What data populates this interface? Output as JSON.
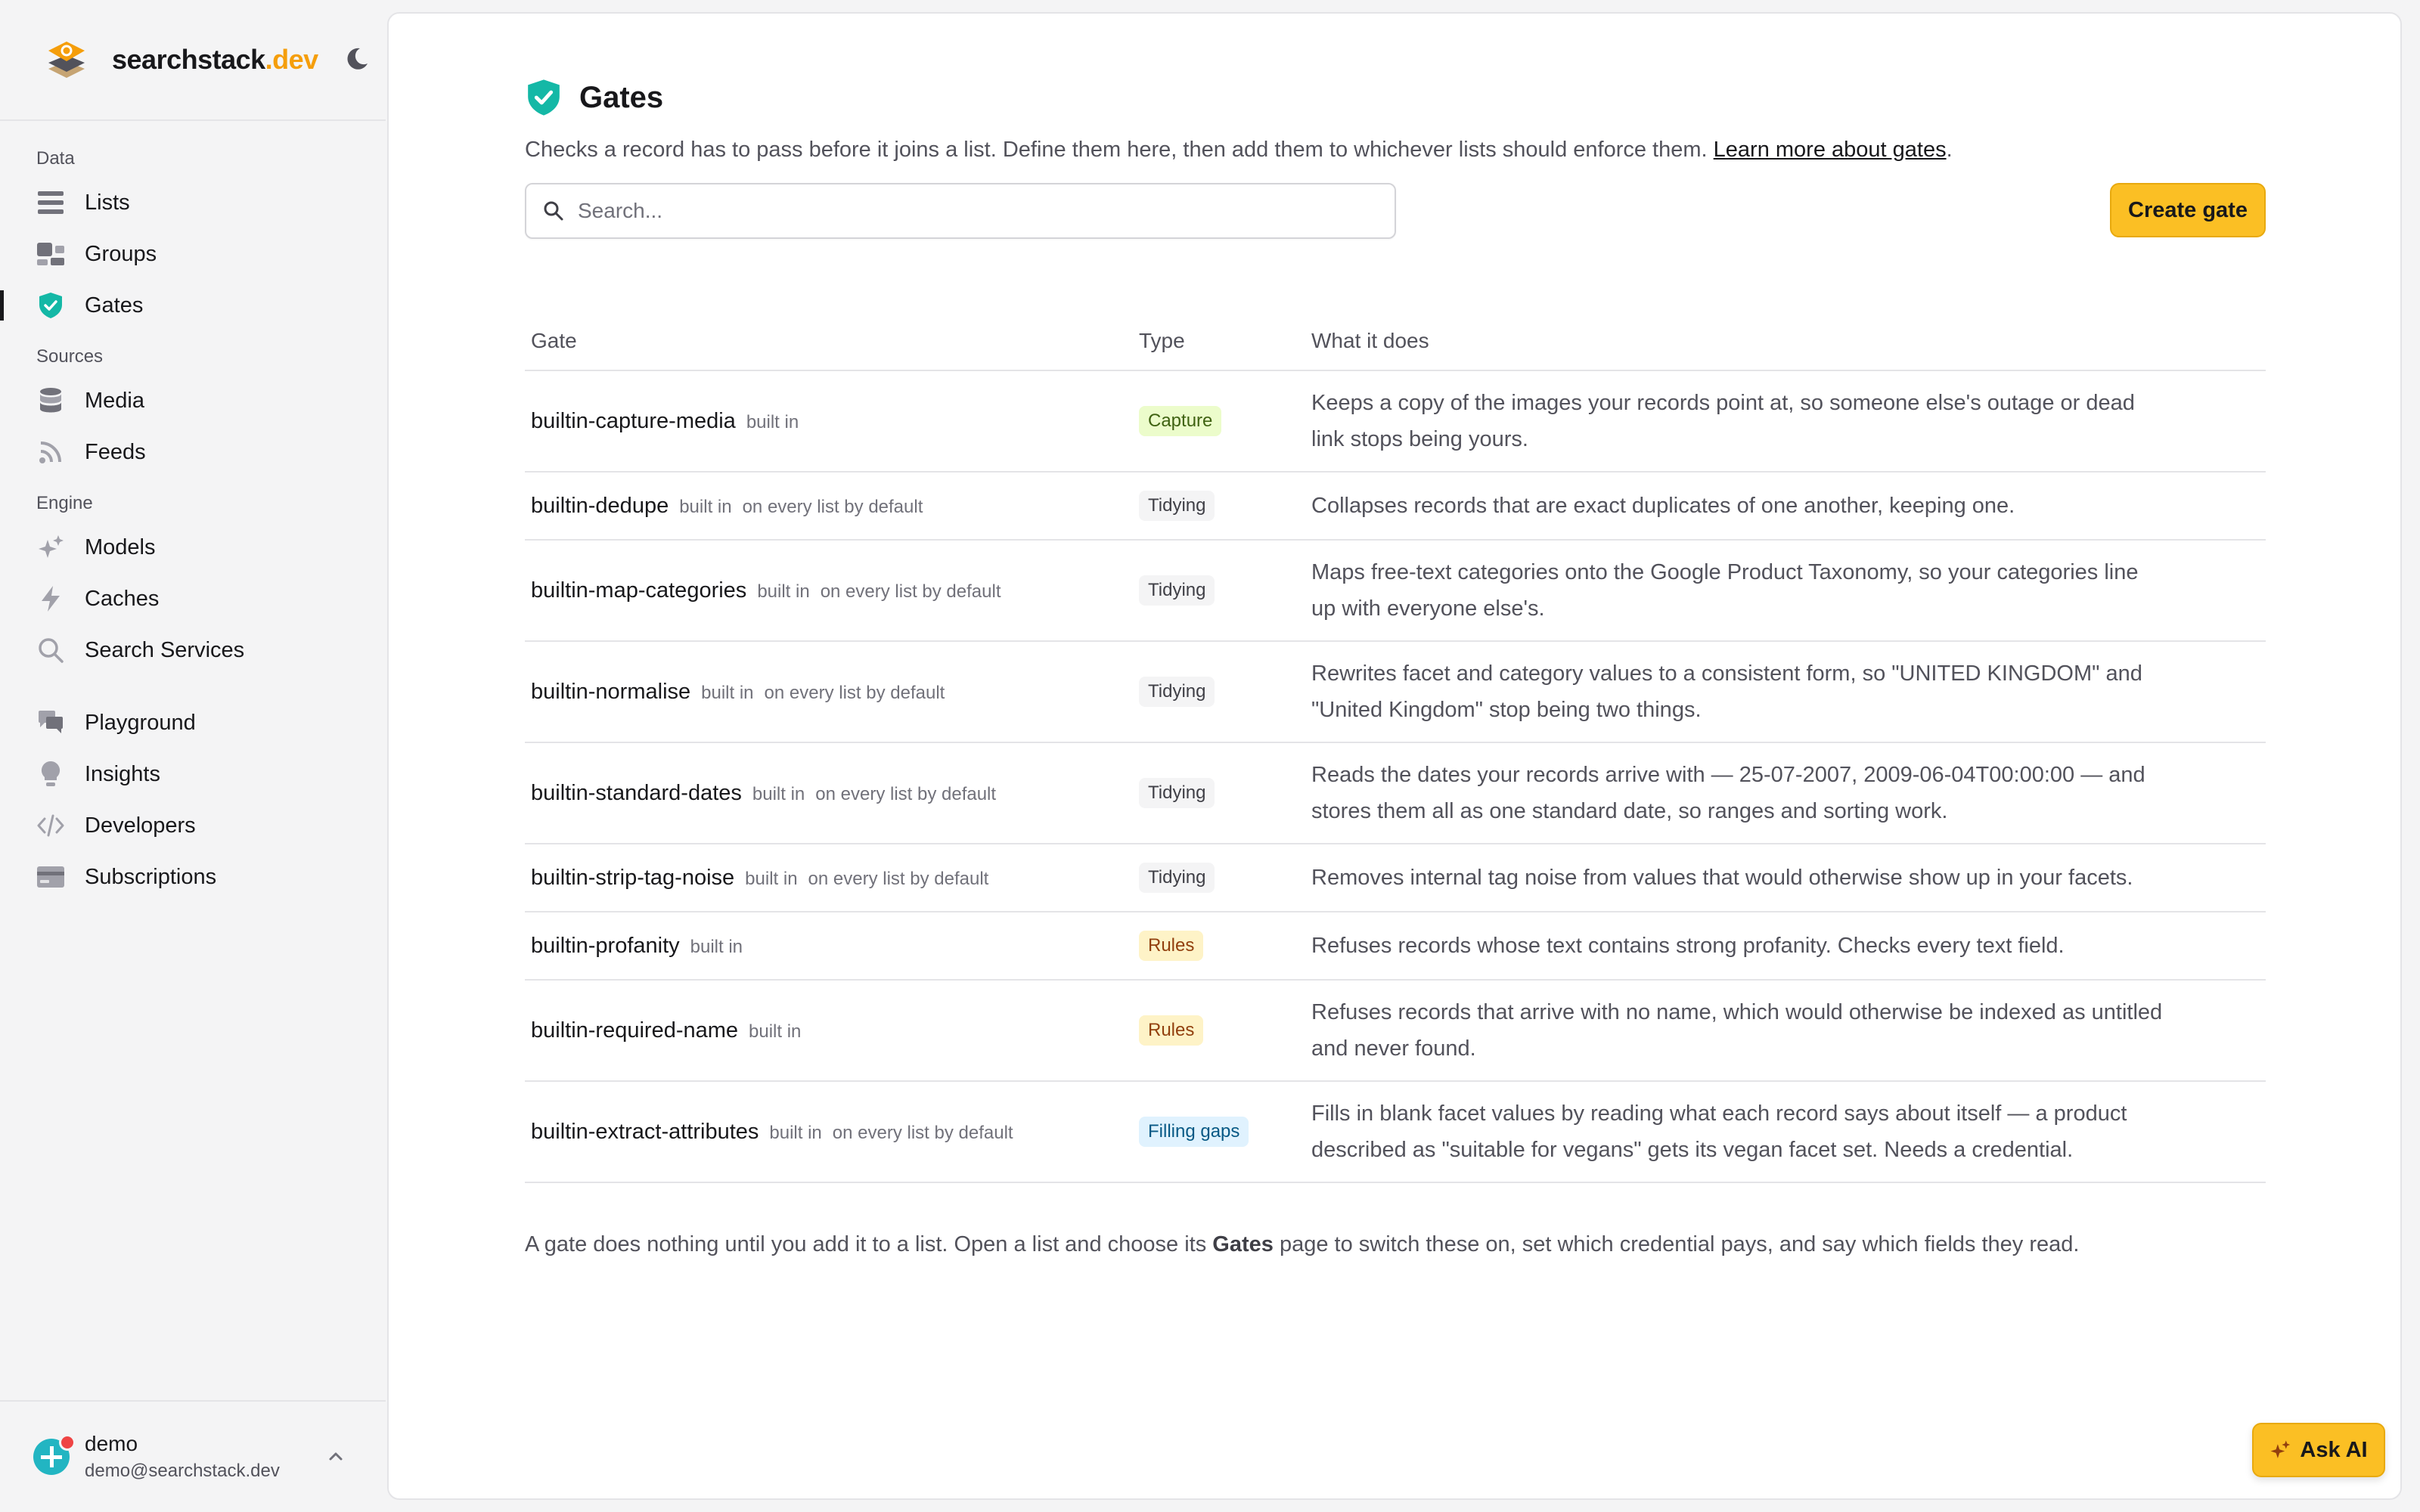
{
  "brand": {
    "name": "searchstack",
    "suffix": ".dev",
    "accent_color": "#f59e0b"
  },
  "sidebar": {
    "sections": [
      {
        "title": "Data",
        "items": [
          {
            "label": "Lists",
            "icon": "list-icon"
          },
          {
            "label": "Groups",
            "icon": "groups-icon"
          },
          {
            "label": "Gates",
            "icon": "shield-check-icon",
            "active": true
          }
        ]
      },
      {
        "title": "Sources",
        "items": [
          {
            "label": "Media",
            "icon": "database-icon"
          },
          {
            "label": "Feeds",
            "icon": "rss-icon"
          }
        ]
      },
      {
        "title": "Engine",
        "items": [
          {
            "label": "Models",
            "icon": "sparkles-icon"
          },
          {
            "label": "Caches",
            "icon": "lightning-icon"
          },
          {
            "label": "Search Services",
            "icon": "search-icon"
          }
        ]
      },
      {
        "title": "",
        "items": [
          {
            "label": "Playground",
            "icon": "chat-icon"
          },
          {
            "label": "Insights",
            "icon": "lightbulb-icon"
          },
          {
            "label": "Developers",
            "icon": "code-icon"
          },
          {
            "label": "Subscriptions",
            "icon": "credit-card-icon"
          }
        ]
      }
    ]
  },
  "user": {
    "name": "demo",
    "email": "demo@searchstack.dev"
  },
  "page": {
    "title": "Gates",
    "subtitle": "Checks a record has to pass before it joins a list. Define them here, then add them to whichever lists should enforce them.",
    "learn_more": "Learn more about gates",
    "subtitle_end": "."
  },
  "search": {
    "placeholder": "Search..."
  },
  "create_button": "Create gate",
  "table": {
    "headers": [
      "Gate",
      "Type",
      "What it does"
    ],
    "rows": [
      {
        "name": "builtin-capture-media",
        "builtin": "built in",
        "default": "",
        "type": "Capture",
        "description": "Keeps a copy of the images your records point at, so someone else's outage or dead link stops being yours."
      },
      {
        "name": "builtin-dedupe",
        "builtin": "built in",
        "default": "on every list by default",
        "type": "Tidying",
        "description": "Collapses records that are exact duplicates of one another, keeping one."
      },
      {
        "name": "builtin-map-categories",
        "builtin": "built in",
        "default": "on every list by default",
        "type": "Tidying",
        "description": "Maps free-text categories onto the Google Product Taxonomy, so your categories line up with everyone else's."
      },
      {
        "name": "builtin-normalise",
        "builtin": "built in",
        "default": "on every list by default",
        "type": "Tidying",
        "description": "Rewrites facet and category values to a consistent form, so \"UNITED KINGDOM\" and \"United Kingdom\" stop being two things."
      },
      {
        "name": "builtin-standard-dates",
        "builtin": "built in",
        "default": "on every list by default",
        "type": "Tidying",
        "description": "Reads the dates your records arrive with — 25-07-2007, 2009-06-04T00:00:00 — and stores them all as one standard date, so ranges and sorting work."
      },
      {
        "name": "builtin-strip-tag-noise",
        "builtin": "built in",
        "default": "on every list by default",
        "type": "Tidying",
        "description": "Removes internal tag noise from values that would otherwise show up in your facets."
      },
      {
        "name": "builtin-profanity",
        "builtin": "built in",
        "default": "",
        "type": "Rules",
        "description": "Refuses records whose text contains strong profanity. Checks every text field."
      },
      {
        "name": "builtin-required-name",
        "builtin": "built in",
        "default": "",
        "type": "Rules",
        "description": "Refuses records that arrive with no name, which would otherwise be indexed as untitled and never found."
      },
      {
        "name": "builtin-extract-attributes",
        "builtin": "built in",
        "default": "on every list by default",
        "type": "Filling gaps",
        "description": "Fills in blank facet values by reading what each record says about itself — a product described as \"suitable for vegans\" gets its vegan facet set. Needs a credential."
      }
    ]
  },
  "badge_styles": {
    "Capture": {
      "bg": "#ecfccb",
      "fg": "#3f6212"
    },
    "Tidying": {
      "bg": "#f4f4f5",
      "fg": "#3f3f46"
    },
    "Rules": {
      "bg": "#fef3c7",
      "fg": "#92400e"
    },
    "Filling gaps": {
      "bg": "#e0f2fe",
      "fg": "#075985"
    }
  },
  "footnote": {
    "before": "A gate does nothing until you add it to a list. Open a list and choose its",
    "bold": "Gates",
    "after": "page to switch these on, set which credential pays, and say which fields they read."
  },
  "ask_ai": "Ask AI"
}
